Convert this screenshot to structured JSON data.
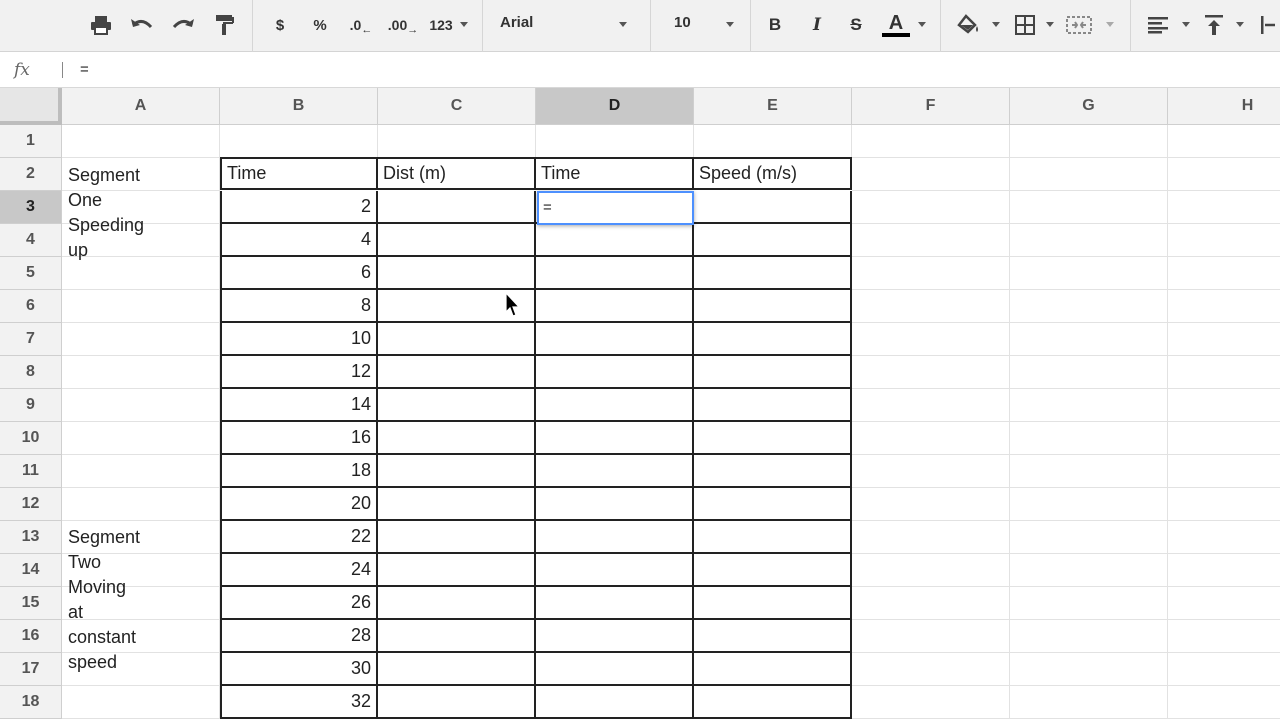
{
  "toolbar": {
    "print_icon": "print-icon",
    "undo_icon": "undo-icon",
    "redo_icon": "redo-icon",
    "paint_format_icon": "paint-format-icon",
    "currency_label": "$",
    "percent_label": "%",
    "decrease_decimal_label": ".0",
    "increase_decimal_label": ".00",
    "more_formats_label": "123",
    "font_family": "Arial",
    "font_size": "10",
    "bold_label": "B",
    "italic_label": "I",
    "strike_label": "S",
    "text_color_label": "A",
    "text_color": "#000000"
  },
  "formula_bar": {
    "fx_label": "fx",
    "value": "="
  },
  "columns": [
    "A",
    "B",
    "C",
    "D",
    "E",
    "F",
    "G",
    "H"
  ],
  "selected_column": "D",
  "rows": [
    "1",
    "2",
    "3",
    "4",
    "5",
    "6",
    "7",
    "8",
    "9",
    "10",
    "11",
    "12",
    "13",
    "14",
    "15",
    "16",
    "17",
    "18"
  ],
  "selected_row": "3",
  "headers": {
    "b": "Time",
    "c": "Dist (m)",
    "d": "Time",
    "e": "Speed (m/s)"
  },
  "segments": {
    "one": "Segment One\nSpeeding up",
    "two": "Segment Two\nMoving at\nconstant speed"
  },
  "time_values": [
    "2",
    "4",
    "6",
    "8",
    "10",
    "12",
    "14",
    "16",
    "18",
    "20",
    "22",
    "24",
    "26",
    "28",
    "30",
    "32"
  ],
  "active_cell": {
    "ref": "D3",
    "value": "="
  }
}
